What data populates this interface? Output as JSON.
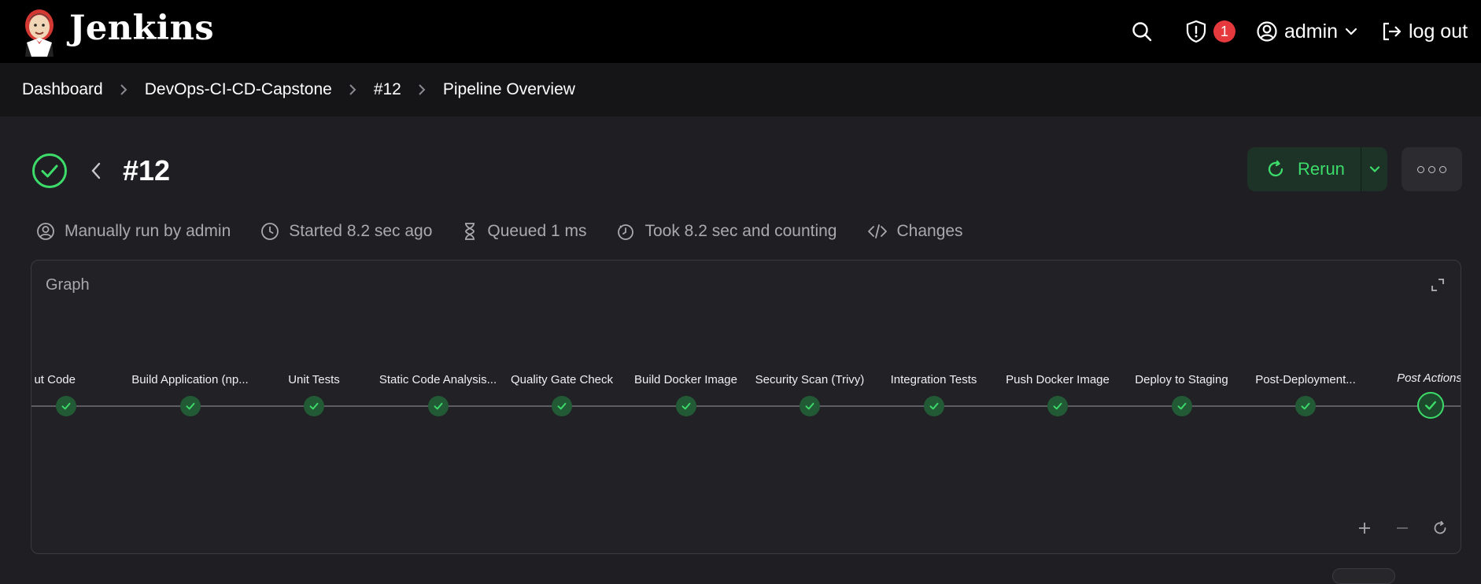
{
  "header": {
    "brand": "Jenkins",
    "alerts_count": "1",
    "user": "admin",
    "logout_label": "log out"
  },
  "breadcrumb": [
    "Dashboard",
    "DevOps-CI-CD-Capstone",
    "#12",
    "Pipeline Overview"
  ],
  "run": {
    "title": "#12",
    "rerun_label": "Rerun"
  },
  "meta": {
    "trigger": "Manually run by admin",
    "started": "Started 8.2 sec ago",
    "queued": "Queued 1 ms",
    "duration": "Took 8.2 sec and counting",
    "changes": "Changes"
  },
  "graph": {
    "title": "Graph",
    "stages": [
      {
        "label": "ut Code",
        "status": "success"
      },
      {
        "label": "Build Application (np...",
        "status": "success"
      },
      {
        "label": "Unit Tests",
        "status": "success"
      },
      {
        "label": "Static Code Analysis...",
        "status": "success"
      },
      {
        "label": "Quality Gate Check",
        "status": "success"
      },
      {
        "label": "Build Docker Image",
        "status": "success"
      },
      {
        "label": "Security Scan (Trivy)",
        "status": "success"
      },
      {
        "label": "Integration Tests",
        "status": "success"
      },
      {
        "label": "Push Docker Image",
        "status": "success"
      },
      {
        "label": "Deploy to Staging",
        "status": "success"
      },
      {
        "label": "Post-Deployment...",
        "status": "success"
      },
      {
        "label": "Post Actions",
        "status": "success"
      }
    ]
  },
  "colors": {
    "success": "#3ddc6a",
    "badge": "#e5393e"
  }
}
